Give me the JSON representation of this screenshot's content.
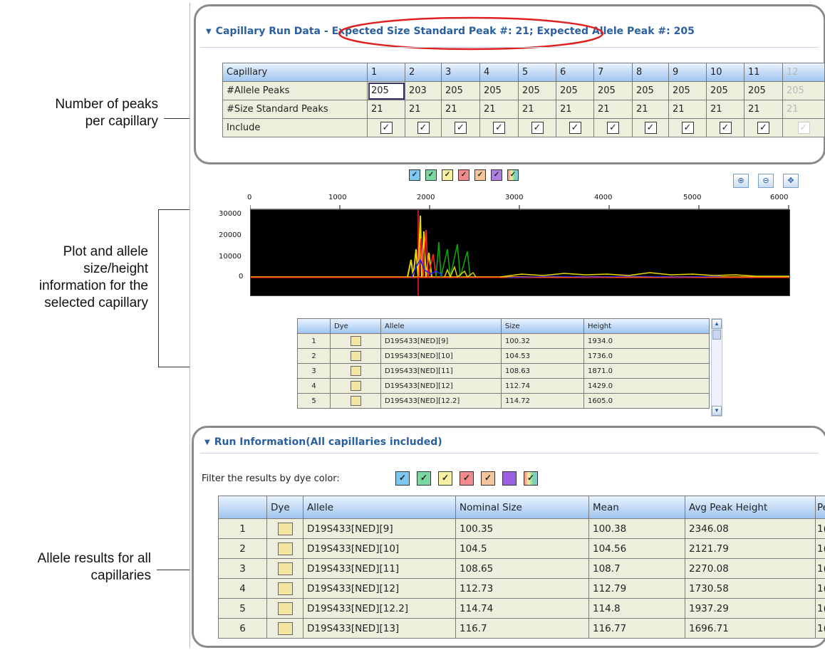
{
  "annotations": {
    "peaks_line1": "Number of peaks",
    "peaks_line2": "per capillary",
    "plot_line1": "Plot and allele",
    "plot_line2": "size/height",
    "plot_line3": "information for the",
    "plot_line4": "selected capillary",
    "allele_line1": "Allele results for all",
    "allele_line2": "capillaries"
  },
  "capillary_section": {
    "title": "Capillary Run Data",
    "separator": "-",
    "expected": "Expected Size Standard Peak #: 21; Expected Allele Peak #: 205",
    "highlight_color": "#e02020",
    "columns": [
      "1",
      "2",
      "3",
      "4",
      "5",
      "6",
      "7",
      "8",
      "9",
      "10",
      "11",
      "12"
    ],
    "rows": [
      {
        "label": "Capillary"
      },
      {
        "label": "#Allele Peaks",
        "values": [
          "205",
          "203",
          "205",
          "205",
          "205",
          "205",
          "205",
          "205",
          "205",
          "205",
          "205",
          "205"
        ]
      },
      {
        "label": "#Size Standard Peaks",
        "values": [
          "21",
          "21",
          "21",
          "21",
          "21",
          "21",
          "21",
          "21",
          "21",
          "21",
          "21",
          "21"
        ]
      },
      {
        "label": "Include",
        "checked": true,
        "check_mark": "✓"
      }
    ],
    "selected_capillary": "1"
  },
  "dye_filters": {
    "colors": [
      "#7cc8f0",
      "#7ad8a0",
      "#f6f0a0",
      "#f28c8c",
      "#f6c49a",
      "#b07ee0",
      "#a0a0a0"
    ],
    "check_mark": "✓"
  },
  "plot_toolbar": {
    "zoom_in_icon": "⊕",
    "zoom_out_icon": "⊖",
    "reset_icon": "✥"
  },
  "plot": {
    "x_ticks": [
      "0",
      "1000",
      "2000",
      "3000",
      "4000",
      "5000",
      "6000"
    ],
    "y_ticks": [
      "30000",
      "20000",
      "10000",
      "0"
    ],
    "background": "#000000",
    "trace_colors": [
      "#ff2020",
      "#e6d800",
      "#10a010",
      "#2020ff",
      "#e88a00"
    ]
  },
  "selected_alleles": {
    "headers": [
      "",
      "Dye",
      "Allele",
      "Size",
      "Height"
    ],
    "rows": [
      {
        "idx": "1",
        "allele": "D19S433[NED][9]",
        "size": "100.32",
        "height": "1934.0"
      },
      {
        "idx": "2",
        "allele": "D19S433[NED][10]",
        "size": "104.53",
        "height": "1736.0"
      },
      {
        "idx": "3",
        "allele": "D19S433[NED][11]",
        "size": "108.63",
        "height": "1871.0"
      },
      {
        "idx": "4",
        "allele": "D19S433[NED][12]",
        "size": "112.74",
        "height": "1429.0"
      },
      {
        "idx": "5",
        "allele": "D19S433[NED][12.2]",
        "size": "114.72",
        "height": "1605.0"
      }
    ],
    "scroll_up": "▲",
    "scroll_down": "▼"
  },
  "run_info": {
    "title": "Run Information(All capillaries included)",
    "filter_label": "Filter the results by dye color:",
    "headers": [
      "",
      "Dye",
      "Allele",
      "Nominal Size",
      "Mean",
      "Avg Peak Height",
      "Pe"
    ],
    "rows": [
      {
        "idx": "1",
        "allele": "D19S433[NED][9]",
        "nominal": "100.35",
        "mean": "100.38",
        "avg": "2346.08",
        "pe": "1("
      },
      {
        "idx": "2",
        "allele": "D19S433[NED][10]",
        "nominal": "104.5",
        "mean": "104.56",
        "avg": "2121.79",
        "pe": "1("
      },
      {
        "idx": "3",
        "allele": "D19S433[NED][11]",
        "nominal": "108.65",
        "mean": "108.7",
        "avg": "2270.08",
        "pe": "1("
      },
      {
        "idx": "4",
        "allele": "D19S433[NED][12]",
        "nominal": "112.73",
        "mean": "112.79",
        "avg": "1730.58",
        "pe": "1("
      },
      {
        "idx": "5",
        "allele": "D19S433[NED][12.2]",
        "nominal": "114.74",
        "mean": "114.8",
        "avg": "1937.29",
        "pe": "1("
      },
      {
        "idx": "6",
        "allele": "D19S433[NED][13]",
        "nominal": "116.7",
        "mean": "116.77",
        "avg": "1696.71",
        "pe": "1("
      }
    ]
  }
}
